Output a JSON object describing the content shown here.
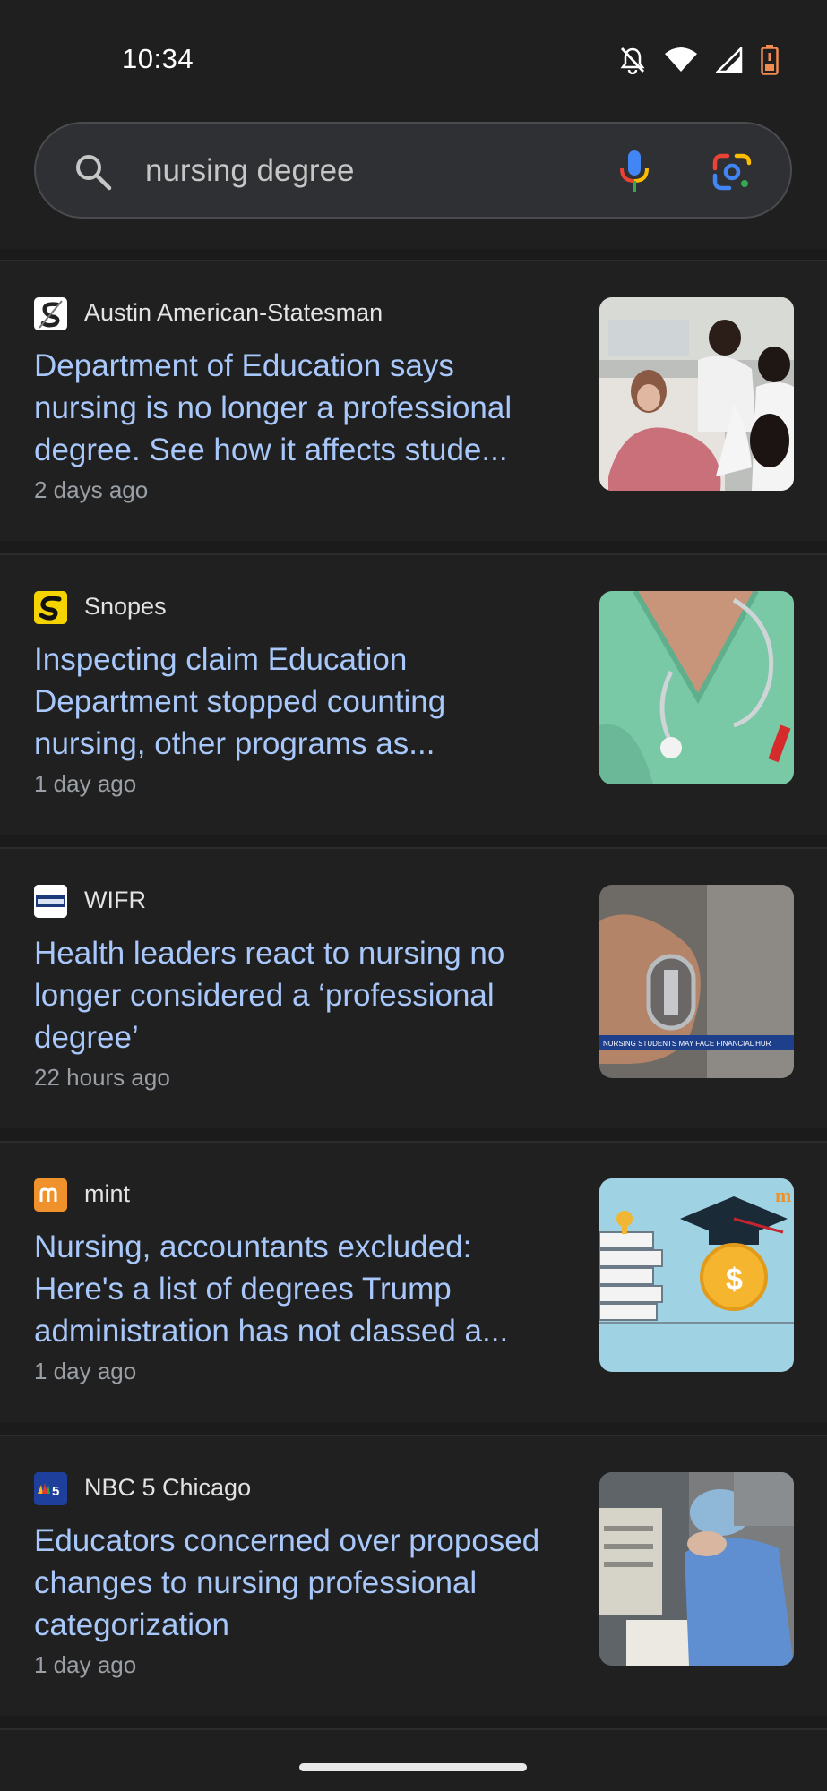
{
  "status_bar": {
    "time": "10:34",
    "icons": [
      "bell-off-icon",
      "wifi-icon",
      "cellular-signal-icon",
      "battery-icon"
    ]
  },
  "search": {
    "query": "nursing degree",
    "icons": [
      "search-icon",
      "microphone-icon",
      "google-lens-icon"
    ]
  },
  "results": [
    {
      "source": "Austin American-Statesman",
      "headline": "Department of Education says nursing is no longer a professional degree. See how it affects stude...",
      "age": "2 days ago",
      "favicon": "statesman-logo-icon"
    },
    {
      "source": "Snopes",
      "headline": "Inspecting claim Education Department stopped counting nursing, other programs as...",
      "age": "1 day ago",
      "favicon": "snopes-logo-icon"
    },
    {
      "source": "WIFR",
      "headline": "Health leaders react to nursing no longer considered a ‘professional degree’",
      "age": "22 hours ago",
      "favicon": "wifr-logo-icon",
      "thumb_caption": "NURSING STUDENTS MAY FACE FINANCIAL HUR"
    },
    {
      "source": "mint",
      "headline": "Nursing, accountants excluded: Here's a list of degrees Trump administration has not classed a...",
      "age": "1 day ago",
      "favicon": "mint-logo-icon"
    },
    {
      "source": "NBC 5 Chicago",
      "headline": "Educators concerned over proposed changes to nursing professional categorization",
      "age": "1 day ago",
      "favicon": "nbc5-logo-icon"
    }
  ],
  "colors": {
    "background": "#1f1f1f",
    "headline": "#a8c7fa",
    "secondary_text": "#9aa0a6",
    "search_box": "#2f3033"
  }
}
